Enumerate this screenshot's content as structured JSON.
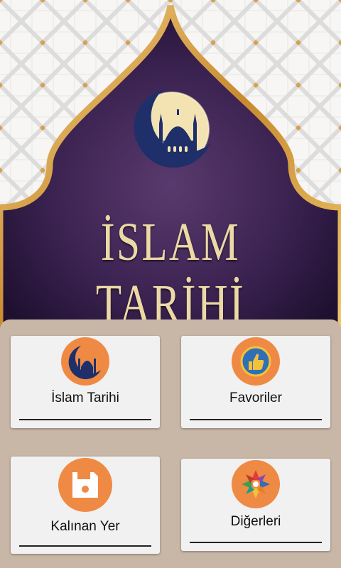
{
  "header": {
    "title": "İSLAM TARİHİ",
    "colors": {
      "purple": "#2f1a3f",
      "gold": "#d9a24a",
      "title": "#ecd9a6"
    },
    "logo": "mosque-crescent-logo"
  },
  "menu": {
    "accent": "#ef8a45",
    "items": [
      {
        "label": "İslam Tarihi",
        "icon": "mosque-icon"
      },
      {
        "label": "Favoriler",
        "icon": "thumbs-up-icon"
      },
      {
        "label": "Kalınan Yer",
        "icon": "save-icon"
      },
      {
        "label": "Diğerleri",
        "icon": "apps-icon"
      }
    ]
  }
}
